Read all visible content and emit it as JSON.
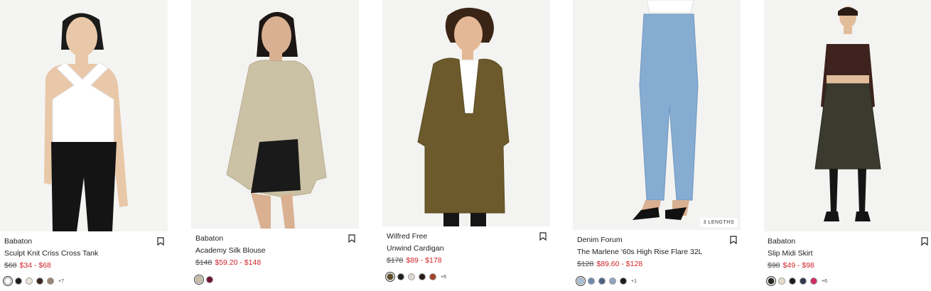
{
  "products": [
    {
      "brand": "Babaton",
      "title": "Sculpt Knit Criss Cross Tank",
      "price_original": "$68",
      "price_sale": "$34 - $68",
      "swatches": [
        "#ffffff",
        "#1e1e1e",
        "#ece6da",
        "#3a2420",
        "#9b8574"
      ],
      "more": "+7",
      "badge": ""
    },
    {
      "brand": "Babaton",
      "title": "Academy Silk Blouse",
      "price_original": "$148",
      "price_sale": "$59.20 - $148",
      "swatches": [
        "#c9bfa5",
        "#6e1530"
      ],
      "more": "",
      "badge": ""
    },
    {
      "brand": "Wilfred Free",
      "title": "Unwind Cardigan",
      "price_original": "$178",
      "price_sale": "$89 - $178",
      "swatches": [
        "#5d4c25",
        "#1f1f1f",
        "#dcd9d1",
        "#2a1d1c",
        "#a1442a"
      ],
      "more": "+6",
      "badge": ""
    },
    {
      "brand": "Denim Forum",
      "title": "The Marlene '60s High Rise Flare 32L",
      "price_original": "$128",
      "price_sale": "$89.60 - $128",
      "swatches": [
        "#a9c1dc",
        "#6f8aae",
        "#4d6283",
        "#8ea4c1",
        "#1d1d1d"
      ],
      "more": "+1",
      "badge": "3 LENGTHS"
    },
    {
      "brand": "Babaton",
      "title": "Slip Midi Skirt",
      "price_original": "$98",
      "price_sale": "$49 - $98",
      "swatches": [
        "#2a2622",
        "#e5dccb",
        "#1d1d1d",
        "#2f3a4e",
        "#d42a62"
      ],
      "more": "+6",
      "badge": ""
    }
  ]
}
